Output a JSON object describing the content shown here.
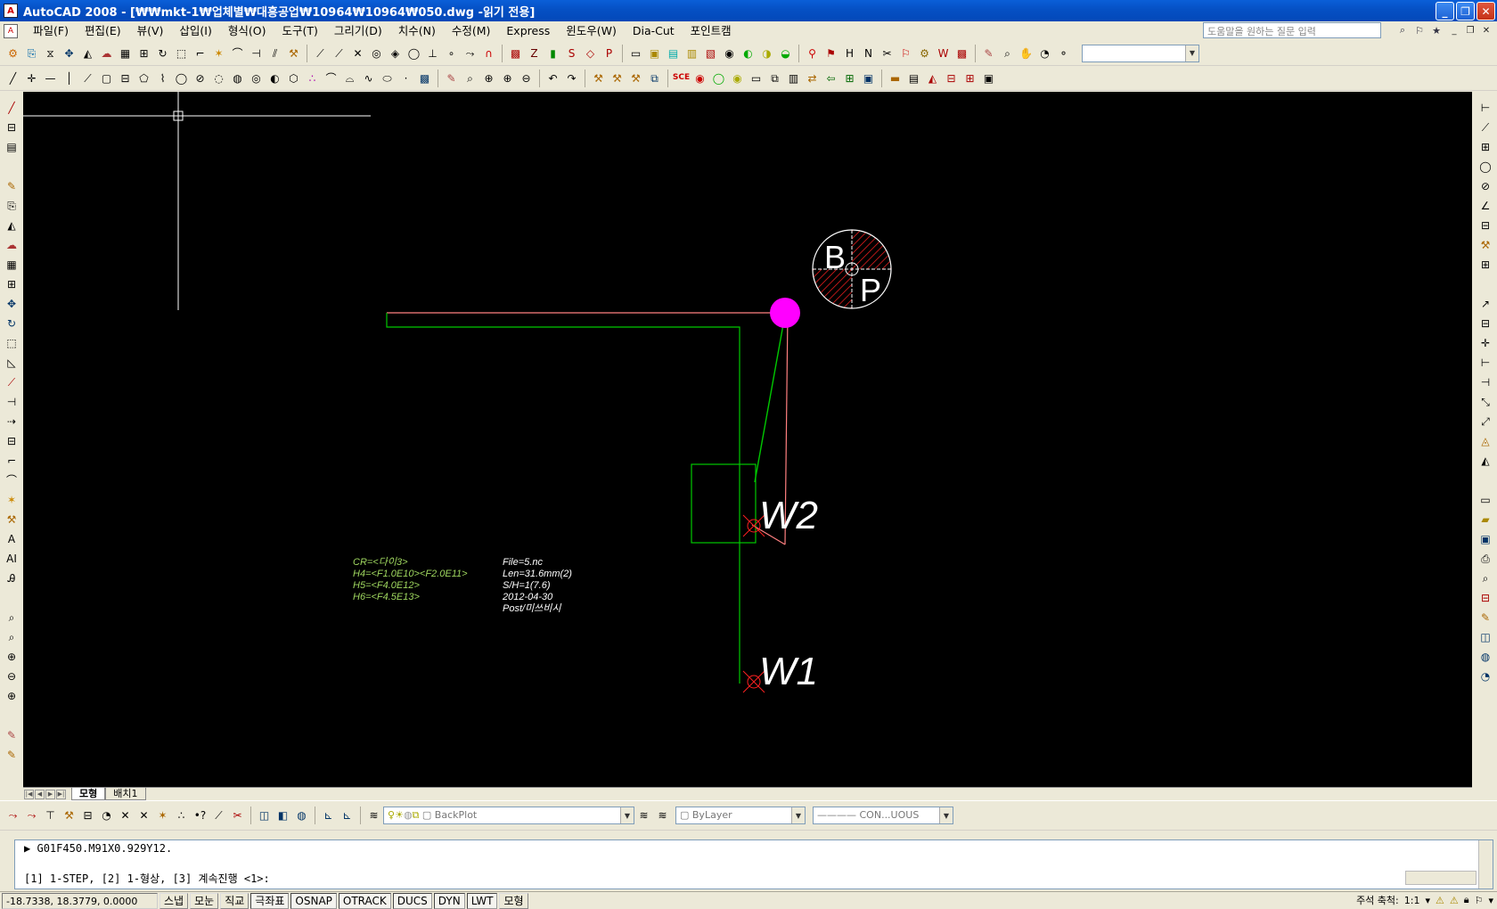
{
  "title_bar": {
    "app_icon": "autocad-icon",
    "title": "AutoCAD 2008 - [₩₩mkt-1₩업체별₩대흥공업₩10964₩10964₩050.dwg -읽기 전용]",
    "minimize": "_",
    "restore": "❐",
    "close": "✕"
  },
  "menu": {
    "items": [
      "파일(F)",
      "편집(E)",
      "뷰(V)",
      "삽입(I)",
      "형식(O)",
      "도구(T)",
      "그리기(D)",
      "치수(N)",
      "수정(M)",
      "Express",
      "윈도우(W)",
      "Dia-Cut",
      "포인트캠"
    ],
    "help_placeholder": "도움말을 원하는 질문 입력"
  },
  "toolbar3": {
    "layer_combo": "BackPlot",
    "color_combo": "ByLayer",
    "linetype_combo": "CON...UOUS"
  },
  "drawing": {
    "bp_label_b": "B",
    "bp_label_p": "P",
    "w1": "W1",
    "w2": "W2",
    "info_left": [
      "CR=<다이3>",
      "H4=<F1.0E10><F2.0E11>",
      "H5=<F4.0E12>",
      "H6=<F4.5E13>"
    ],
    "info_right": [
      "File=5.nc",
      "Len=31.6mm(2)",
      "S/H=1(7.6)",
      "2012-04-30",
      "Post/미쓰비시"
    ],
    "colors": {
      "background": "#000000",
      "green": "#00c800",
      "salmon": "#ff8080",
      "magenta": "#ff00ff",
      "red": "#ff2020",
      "text_green": "#9fd75f",
      "white": "#ffffff"
    }
  },
  "layout_tabs": [
    "모형",
    "배치1"
  ],
  "command": {
    "line1": "G01F450.M91X0.929Y12.",
    "prompt": "[1] 1-STEP, [2] 1-형상, [3] 계속진행 <1>:"
  },
  "status": {
    "coords": "-18.7338, 18.3779, 0.0000",
    "buttons": [
      "스냅",
      "모눈",
      "직교",
      "극좌표",
      "OSNAP",
      "OTRACK",
      "DUCS",
      "DYN",
      "LWT",
      "모형"
    ],
    "active": [
      "극좌표",
      "OSNAP",
      "OTRACK",
      "DUCS",
      "DYN",
      "LWT"
    ],
    "scale_label": "주석 축척:",
    "scale_value": "1:1"
  }
}
